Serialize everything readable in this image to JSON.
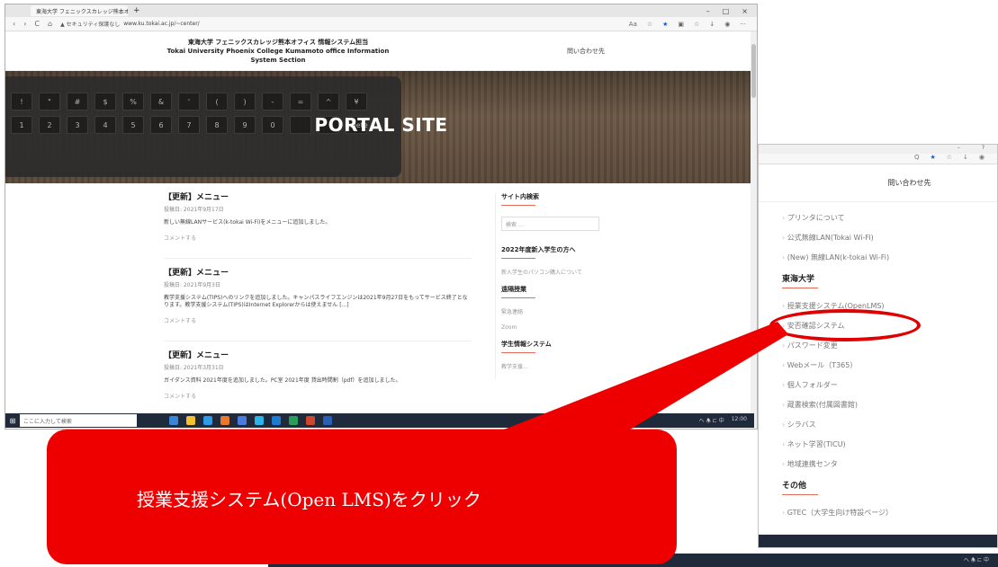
{
  "browser": {
    "tab_title": "東海大学 フェニックスカレッジ熊本オ",
    "tab_close": "×",
    "tab_new": "+",
    "window_controls": [
      "–",
      "□",
      "×"
    ],
    "nav_buttons": [
      "‹",
      "›",
      "C",
      "⌂"
    ],
    "security_label": "▲ セキュリティ保護なし",
    "url": "www.ku.tokai.ac.jp/~center/",
    "nav_right_icons": [
      "Aa",
      "☆",
      "★",
      "▣",
      "☆",
      "↓",
      "◉",
      "···"
    ]
  },
  "site": {
    "title_jp": "東海大学 フェニックスカレッジ熊本オフィス 情報システム担当",
    "title_en": "Tokai University Phoenix College Kumamoto office Information System Section",
    "contact": "問い合わせ先"
  },
  "hero": {
    "title": "PORTAL SITE",
    "keys": [
      "!",
      "\"",
      "#",
      "$",
      "%",
      "&",
      "'",
      "(",
      ")",
      "-",
      "=",
      "^",
      "¥",
      "1",
      "2",
      "3",
      "4",
      "5",
      "6",
      "7",
      "8",
      "9",
      "0",
      "",
      "",
      "delete"
    ]
  },
  "posts": [
    {
      "title": "【更新】メニュー",
      "date": "投稿日: 2021年9月17日",
      "text": "新しい無線LANサービス(k-tokai Wi-Fi)をメニューに追加しました。",
      "comment": "コメントする"
    },
    {
      "title": "【更新】メニュー",
      "date": "投稿日: 2021年9月3日",
      "text": "教学支援システム(TIPS)へのリンクを追加しました。キャンパスライフエンジンは2021年9月27日をもってサービス終了となります。教学支援システム(TIPS)はInternet Explorerからは使えません [...]",
      "comment": "コメントする"
    },
    {
      "title": "【更新】メニュー",
      "date": "投稿日: 2021年3月31日",
      "text": "ガイダンス資料 2021年度を追加しました。PC室 2021年度 貸出時間割（pdf）を追加しました。",
      "comment": "コメントする"
    }
  ],
  "sidebar_main": {
    "search_head": "サイト内検索",
    "search_placeholder": "検索 …",
    "new_students_head": "2022年度新入学生の方へ",
    "new_students_items": [
      "新入学生のパソコン購入について"
    ],
    "online_head": "遠隔授業",
    "online_items": [
      "緊急連絡",
      "Zoom"
    ],
    "student_sys_head": "学生情報システム",
    "student_sys_items": [
      "教学支援…"
    ]
  },
  "taskbar": {
    "start": "⊞",
    "search_placeholder": "ここに入力して検索",
    "tray_text": "へ 🕭 ⊏ 中",
    "clock": "12:00"
  },
  "zoom_panel": {
    "contact": "問い合わせ先",
    "top_controls": [
      "–",
      "?"
    ],
    "nav_icons": [
      "Q",
      "★",
      "☆",
      "↓",
      "◉"
    ],
    "items_top": [
      "プリンタについて",
      "公式無線LAN(Tokai Wi-Fi)",
      "(New) 無線LAN(k-tokai Wi-Fi)"
    ],
    "section_tokai": "東海大学",
    "items_tokai": [
      "授業支援システム(OpenLMS)",
      "安否確認システム",
      "パスワード変更",
      "Webメール（T365）",
      "個人フォルダー",
      "蔵書検索(付属図書館)",
      "シラバス",
      "ネット学習(TICU)",
      "地域連携センタ"
    ],
    "section_other": "その他",
    "items_other": [
      "GTEC（大学生向け特設ページ）"
    ]
  },
  "callout": {
    "text": "授業支援システム(Open LMS)をクリック",
    "color": "#ee0000"
  },
  "highlight": {
    "target": "授業支援システム(OpenLMS)",
    "color": "#e00000"
  }
}
